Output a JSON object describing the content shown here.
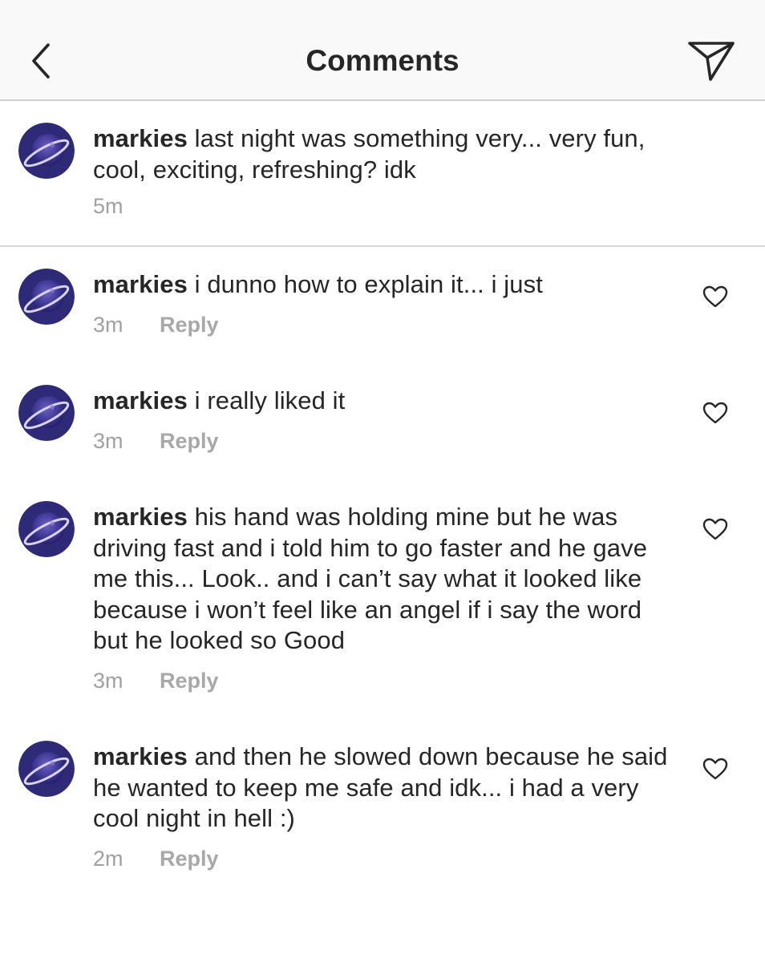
{
  "header": {
    "title": "Comments",
    "back_icon": "chevron-left-icon",
    "share_icon": "paper-plane-icon"
  },
  "caption": {
    "username": "markies",
    "text": " last night was something very... very fun, cool, exciting, refreshing? idk",
    "time": "5m"
  },
  "comments": [
    {
      "username": "markies",
      "text": " i dunno how to explain it... i just",
      "time": "3m",
      "reply_label": "Reply"
    },
    {
      "username": "markies",
      "text": " i really liked it",
      "time": "3m",
      "reply_label": "Reply"
    },
    {
      "username": "markies",
      "text": " his hand was holding mine but he was driving fast and i told him to go faster and he gave me this... Look.. and i can’t say what it looked like because i won’t feel like an angel if i say the word but he looked so Good",
      "time": "3m",
      "reply_label": "Reply"
    },
    {
      "username": "markies",
      "text": " and then he slowed down because he said he wanted to keep me safe and idk... i had a very cool night in hell :)",
      "time": "2m",
      "reply_label": "Reply"
    }
  ],
  "colors": {
    "text": "#262626",
    "secondary": "#a0a0a0",
    "divider": "#d7d7d7",
    "header_bg": "#f9f9f9",
    "avatar_bg": "#2e2a78",
    "avatar_ring": "#d9d3f0"
  },
  "icons": {
    "avatar": "planet-avatar-icon",
    "like": "heart-outline-icon"
  }
}
